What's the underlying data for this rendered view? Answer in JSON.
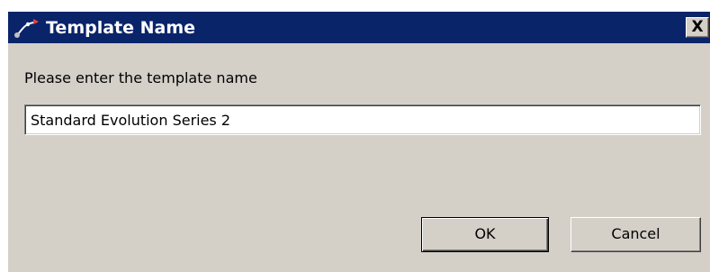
{
  "dialog": {
    "title": "Template Name",
    "close_label": "X",
    "prompt": "Please enter the template name",
    "input": {
      "value": "Standard Evolution Series 2",
      "placeholder": ""
    },
    "buttons": {
      "ok": "OK",
      "cancel": "Cancel"
    }
  },
  "icons": {
    "title": "template-connector-icon",
    "close": "close-icon"
  },
  "colors": {
    "titlebar": "#0a246a",
    "dialog_background": "#d4d0c8",
    "title_text": "#ffffff",
    "icon_accent": "#ff3b3b"
  }
}
